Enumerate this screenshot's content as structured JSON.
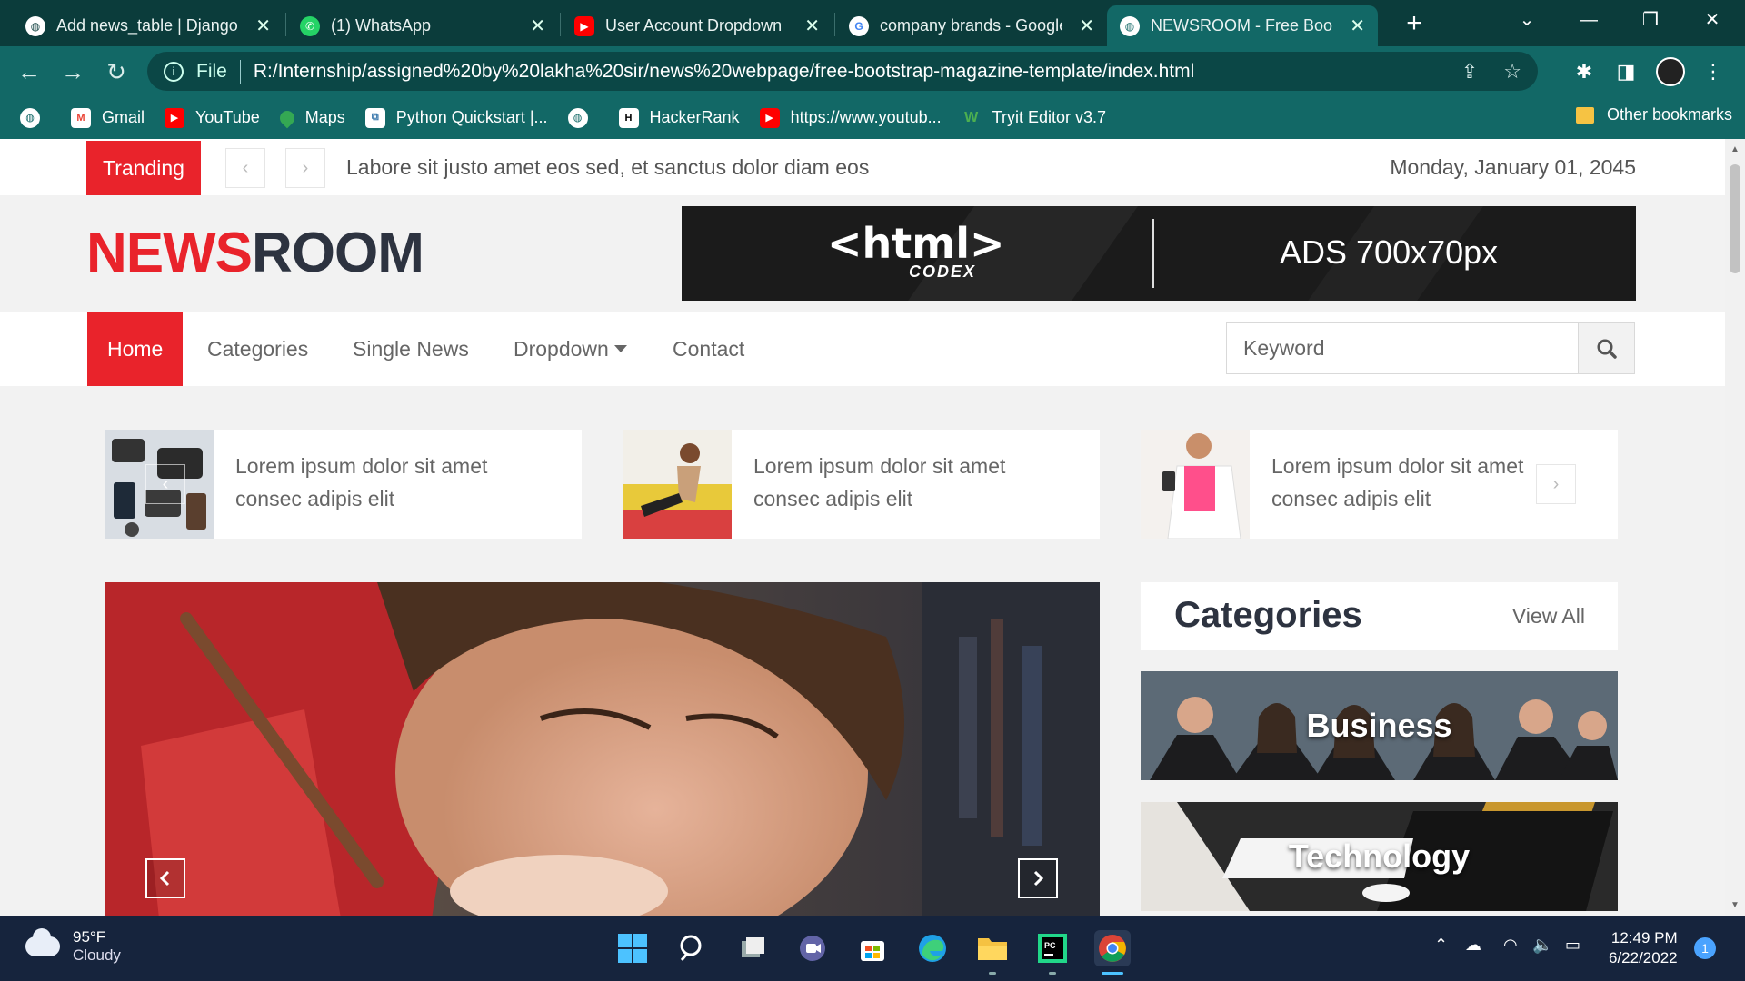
{
  "browser": {
    "tabs": [
      {
        "title": "Add news_table | Django",
        "icon": "globe-icon"
      },
      {
        "title": "(1) WhatsApp",
        "icon": "whatsapp-icon"
      },
      {
        "title": "User Account Dropdown",
        "icon": "youtube-icon"
      },
      {
        "title": "company brands - Google",
        "icon": "google-icon"
      },
      {
        "title": "NEWSROOM - Free Boots",
        "icon": "globe-icon",
        "active": true
      }
    ],
    "url_scheme": "File",
    "url": "R:/Internship/assigned%20by%20lakha%20sir/news%20webpage/free-bootstrap-magazine-template/index.html",
    "bookmarks": [
      {
        "label": "",
        "icon": "globe-icon"
      },
      {
        "label": "Gmail",
        "icon": "gmail-icon"
      },
      {
        "label": "YouTube",
        "icon": "youtube-icon"
      },
      {
        "label": "Maps",
        "icon": "maps-icon"
      },
      {
        "label": "Python Quickstart |...",
        "icon": "python-icon"
      },
      {
        "label": "",
        "icon": "globe-icon"
      },
      {
        "label": "HackerRank",
        "icon": "hackerrank-icon"
      },
      {
        "label": "https://www.youtub...",
        "icon": "youtube-icon"
      },
      {
        "label": "Tryit Editor v3.7",
        "icon": "w3schools-icon"
      }
    ],
    "other_bookmarks": "Other bookmarks"
  },
  "page": {
    "trending_label": "Tranding",
    "trending_text": "Labore sit justo amet eos sed, et sanctus dolor diam eos",
    "date": "Monday, January 01, 2045",
    "logo_part1": "NEWS",
    "logo_part2": "ROOM",
    "ad": {
      "logo": "<html>",
      "sub": "CODEX",
      "text": "ADS 700x70px"
    },
    "nav": {
      "home": "Home",
      "categories": "Categories",
      "single_news": "Single News",
      "dropdown": "Dropdown",
      "contact": "Contact"
    },
    "search_placeholder": "Keyword",
    "mini_news": [
      {
        "line1": "Lorem ipsum dolor sit amet",
        "line2": "consec adipis elit"
      },
      {
        "line1": "Lorem ipsum dolor sit amet",
        "line2": "consec adipis elit"
      },
      {
        "line1": "Lorem ipsum dolor sit amet",
        "line2": "consec adipis elit"
      }
    ],
    "categories_title": "Categories",
    "view_all": "View All",
    "category_cards": [
      {
        "label": "Business"
      },
      {
        "label": "Technology"
      }
    ]
  },
  "taskbar": {
    "weather_temp": "95°F",
    "weather_desc": "Cloudy",
    "time": "12:49 PM",
    "date": "6/22/2022",
    "notifications": "1"
  },
  "colors": {
    "accent": "#e9232b",
    "chrome": "#126866",
    "chrome_dark": "#0b3c3b",
    "taskbar": "#16243d"
  }
}
